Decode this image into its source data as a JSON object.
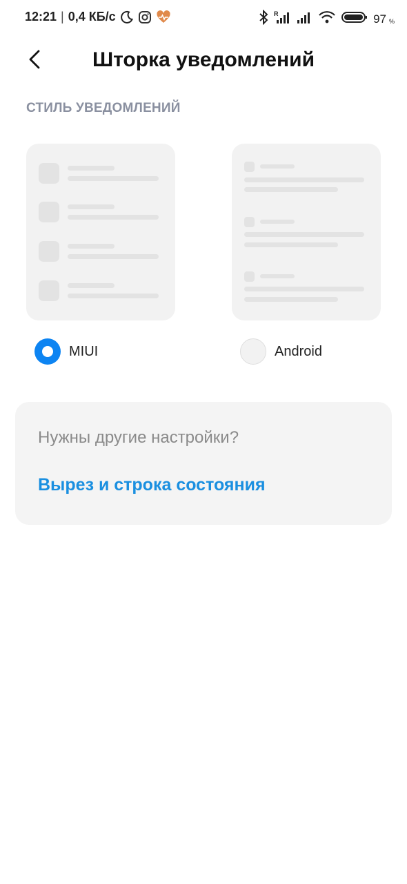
{
  "status_bar": {
    "time": "12:21",
    "separator": "|",
    "speed": "0,4 КБ/с",
    "battery_level": "97",
    "battery_unit": "%",
    "icons": [
      "moon-icon",
      "instagram-icon",
      "health-icon",
      "bluetooth-icon",
      "signal-roaming-icon",
      "signal-icon",
      "wifi-icon",
      "battery-icon"
    ],
    "health_color": "#e0894a"
  },
  "header": {
    "title": "Шторка уведомлений"
  },
  "section": {
    "label": "СТИЛЬ УВЕДОМЛЕНИЙ"
  },
  "options": [
    {
      "label": "MIUI",
      "selected": true
    },
    {
      "label": "Android",
      "selected": false
    }
  ],
  "more": {
    "question": "Нужны другие настройки?",
    "link": "Вырез и строка состояния"
  },
  "colors": {
    "accent": "#0d84f2",
    "link": "#1a8fe0",
    "section_label": "#8a90a0"
  }
}
